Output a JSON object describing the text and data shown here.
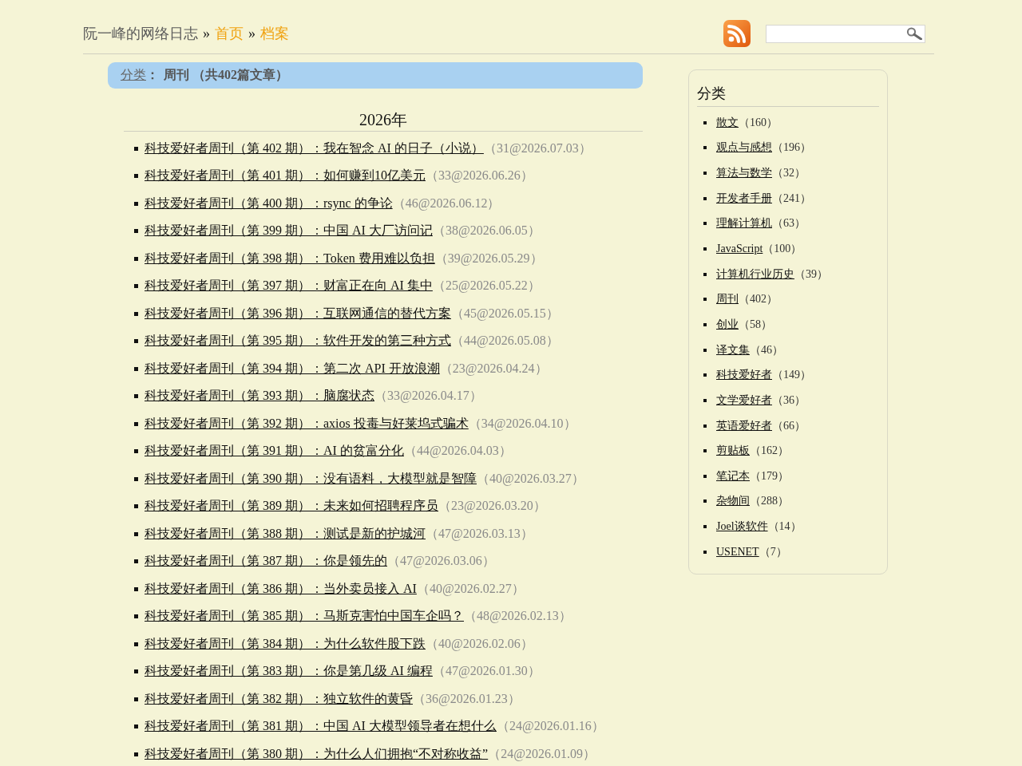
{
  "header": {
    "breadcrumb": [
      {
        "kind": "site",
        "label": "阮一峰的网络日志"
      },
      {
        "kind": "link",
        "separator": "»",
        "label": "首页"
      },
      {
        "kind": "link",
        "separator": "»",
        "label": "档案"
      }
    ]
  },
  "category_bar": {
    "link": "分类",
    "separator": "：",
    "title": "周刊 （共402篇文章）"
  },
  "archive": {
    "year_heading": "2026年",
    "posts": [
      {
        "title": "科技爱好者周刊（第 402 期）：我在智念 AI 的日子（小说）",
        "meta": "（31@2026.07.03）"
      },
      {
        "title": "科技爱好者周刊（第 401 期）：如何赚到10亿美元",
        "meta": "（33@2026.06.26）"
      },
      {
        "title": "科技爱好者周刊（第 400 期）：rsync 的争论",
        "meta": "（46@2026.06.12）"
      },
      {
        "title": "科技爱好者周刊（第 399 期）：中国 AI 大厂访问记",
        "meta": "（38@2026.06.05）"
      },
      {
        "title": "科技爱好者周刊（第 398 期）：Token 费用难以负担",
        "meta": "（39@2026.05.29）"
      },
      {
        "title": "科技爱好者周刊（第 397 期）：财富正在向 AI 集中",
        "meta": "（25@2026.05.22）"
      },
      {
        "title": "科技爱好者周刊（第 396 期）：互联网通信的替代方案",
        "meta": "（45@2026.05.15）"
      },
      {
        "title": "科技爱好者周刊（第 395 期）：软件开发的第三种方式",
        "meta": "（44@2026.05.08）"
      },
      {
        "title": "科技爱好者周刊（第 394 期）：第二次 API 开放浪潮",
        "meta": "（23@2026.04.24）"
      },
      {
        "title": "科技爱好者周刊（第 393 期）：脑腐状态",
        "meta": "（33@2026.04.17）"
      },
      {
        "title": "科技爱好者周刊（第 392 期）：axios 投毒与好莱坞式骗术",
        "meta": "（34@2026.04.10）"
      },
      {
        "title": "科技爱好者周刊（第 391 期）：AI 的贫富分化",
        "meta": "（44@2026.04.03）"
      },
      {
        "title": "科技爱好者周刊（第 390 期）：没有语料，大模型就是智障",
        "meta": "（40@2026.03.27）"
      },
      {
        "title": "科技爱好者周刊（第 389 期）：未来如何招聘程序员",
        "meta": "（23@2026.03.20）"
      },
      {
        "title": "科技爱好者周刊（第 388 期）：测试是新的护城河",
        "meta": "（47@2026.03.13）"
      },
      {
        "title": "科技爱好者周刊（第 387 期）：你是领先的",
        "meta": "（47@2026.03.06）"
      },
      {
        "title": "科技爱好者周刊（第 386 期）：当外卖员接入 AI",
        "meta": "（40@2026.02.27）"
      },
      {
        "title": "科技爱好者周刊（第 385 期）：马斯克害怕中国车企吗？",
        "meta": "（48@2026.02.13）"
      },
      {
        "title": "科技爱好者周刊（第 384 期）：为什么软件股下跌",
        "meta": "（40@2026.02.06）"
      },
      {
        "title": "科技爱好者周刊（第 383 期）：你是第几级 AI 编程",
        "meta": "（47@2026.01.30）"
      },
      {
        "title": "科技爱好者周刊（第 382 期）：独立软件的黄昏",
        "meta": "（36@2026.01.23）"
      },
      {
        "title": "科技爱好者周刊（第 381 期）：中国 AI 大模型领导者在想什么",
        "meta": "（24@2026.01.16）"
      },
      {
        "title": "科技爱好者周刊（第 380 期）：为什么人们拥抱“不对称收益”",
        "meta": "（24@2026.01.09）"
      }
    ]
  },
  "sidebar": {
    "title": "分类",
    "categories": [
      {
        "name": "散文",
        "count": "（160）"
      },
      {
        "name": "观点与感想",
        "count": "（196）"
      },
      {
        "name": "算法与数学",
        "count": "（32）"
      },
      {
        "name": "开发者手册",
        "count": "（241）"
      },
      {
        "name": "理解计算机",
        "count": "（63）"
      },
      {
        "name": "JavaScript",
        "count": "（100）"
      },
      {
        "name": "计算机行业历史",
        "count": "（39）"
      },
      {
        "name": "周刊",
        "count": "（402）"
      },
      {
        "name": "创业",
        "count": "（58）"
      },
      {
        "name": "译文集",
        "count": "（46）"
      },
      {
        "name": "科技爱好者",
        "count": "（149）"
      },
      {
        "name": "文学爱好者",
        "count": "（36）"
      },
      {
        "name": "英语爱好者",
        "count": "（66）"
      },
      {
        "name": "剪贴板",
        "count": "（162）"
      },
      {
        "name": "笔记本",
        "count": "（179）"
      },
      {
        "name": "杂物间",
        "count": "（288）"
      },
      {
        "name": "Joel谈软件",
        "count": "（14）"
      },
      {
        "name": "USENET",
        "count": "（7）"
      }
    ]
  }
}
